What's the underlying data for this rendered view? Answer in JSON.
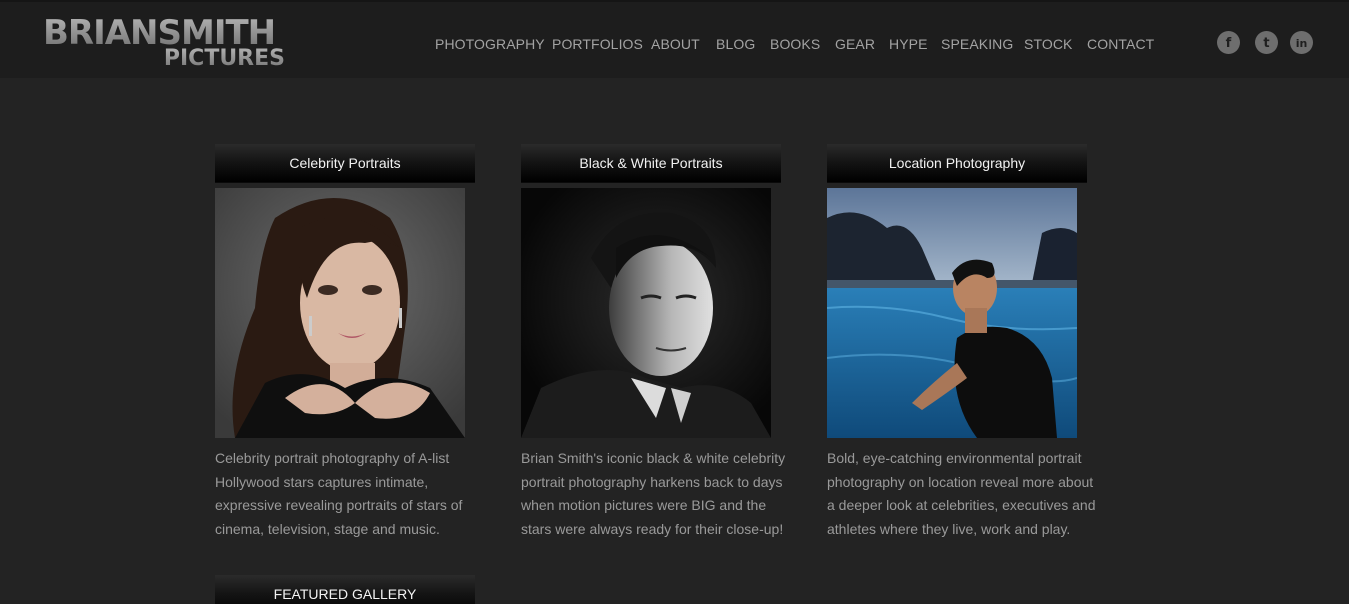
{
  "logo": {
    "line1": "BRIANSMITH",
    "line2": "PICTURES"
  },
  "nav": [
    {
      "label": "PHOTOGRAPHY"
    },
    {
      "label": "PORTFOLIOS"
    },
    {
      "label": "ABOUT"
    },
    {
      "label": "BLOG"
    },
    {
      "label": "BOOKS"
    },
    {
      "label": "GEAR"
    },
    {
      "label": "HYPE"
    },
    {
      "label": "SPEAKING"
    },
    {
      "label": "STOCK"
    },
    {
      "label": "CONTACT"
    }
  ],
  "social": [
    {
      "icon": "facebook-icon",
      "glyph": "f"
    },
    {
      "icon": "twitter-icon",
      "glyph": "t"
    },
    {
      "icon": "linkedin-icon",
      "glyph": "in"
    }
  ],
  "cards": [
    {
      "title": "Celebrity Portraits",
      "description": "Celebrity portrait photography of A-list Hollywood stars captures intimate, expressive revealing portraits of stars of cinema, television, stage and music.",
      "lines": [
        "Celebrity portrait photography of A-list",
        "Hollywood stars captures intimate,",
        "expressive revealing portraits of stars of",
        "cinema, television, stage and music."
      ]
    },
    {
      "title": "Black & White Portraits",
      "description": "Brian Smith's iconic black & white celebrity portrait photography harkens back to days when motion pictures were BIG and the stars were always ready for their close-up!",
      "lines": [
        "Brian Smith's iconic black & white celebrity",
        "portrait photography harkens back to days",
        "when motion pictures were BIG and the",
        "stars were always ready for their close-up!"
      ]
    },
    {
      "title": "Location Photography",
      "description": "Bold, eye-catching environmental portrait photography on location reveal more about a deeper look at celebrities, executives and athletes where they live, work and play.",
      "lines": [
        "Bold, eye-catching environmental portrait",
        "photography on location reveal more about",
        "a deeper look at celebrities, executives and",
        "athletes where they live, work and play."
      ]
    }
  ],
  "featured": {
    "label": "FEATURED GALLERY"
  },
  "colors": {
    "background": "#232323",
    "header": "#1d1d1d",
    "nav_text": "#a3a3a3",
    "desc_text": "#9a9a9a",
    "title_text": "#f2f2f2"
  }
}
